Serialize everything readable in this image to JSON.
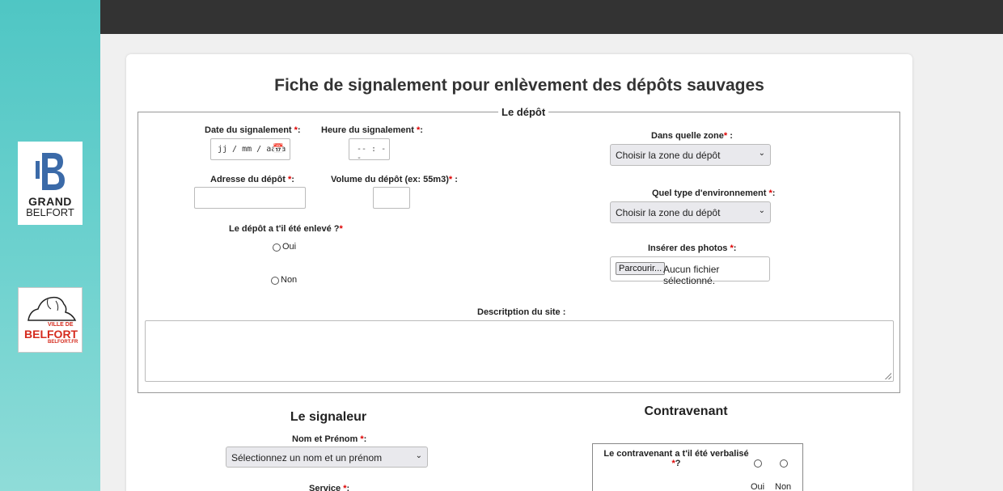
{
  "branding": {
    "grand_belfort_word1": "GRAND",
    "grand_belfort_word2": "BELFORT",
    "ville_line1": "VILLE DE",
    "ville_line2": "BELFORT",
    "ville_line3": "BELFORT.FR",
    "gb_blue": "#3b6aa8",
    "vb_red": "#d52b1e"
  },
  "page": {
    "title": "Fiche de signalement pour enlèvement des dépôts sauvages"
  },
  "depot": {
    "legend": "Le dépôt",
    "date_label": "Date du signalement",
    "date_placeholder": "jj / mm / aaaa",
    "heure_label": "Heure du signalement",
    "heure_placeholder": "-- : --",
    "adresse_label": "Adresse du dépôt",
    "volume_label": "Volume du dépôt (ex: 55m3)",
    "enleve_label": "Le dépôt a t'il été enlevé ?",
    "oui": "Oui",
    "non": "Non",
    "zone_label": "Dans quelle zone",
    "zone_value": "Choisir la zone du dépôt",
    "env_label": "Quel type d'environnement",
    "env_value": "Choisir la zone du dépôt",
    "photos_label": "Insérer des photos",
    "browse_label": "Parcourir...",
    "no_file": "Aucun fichier sélectionné.",
    "desc_label": "Descritption du site :",
    "req_mark": "*",
    "colon": ":"
  },
  "signaleur": {
    "heading": "Le signaleur",
    "nom_label": "Nom et Prénom",
    "nom_value": "Sélectionnez un nom et un prénom",
    "service_label": "Service"
  },
  "contravenant": {
    "heading": "Contravenant",
    "verbalise_label": "Le contravenant a t'il été verbalisé",
    "q": "?",
    "oui": "Oui",
    "non": "Non"
  }
}
